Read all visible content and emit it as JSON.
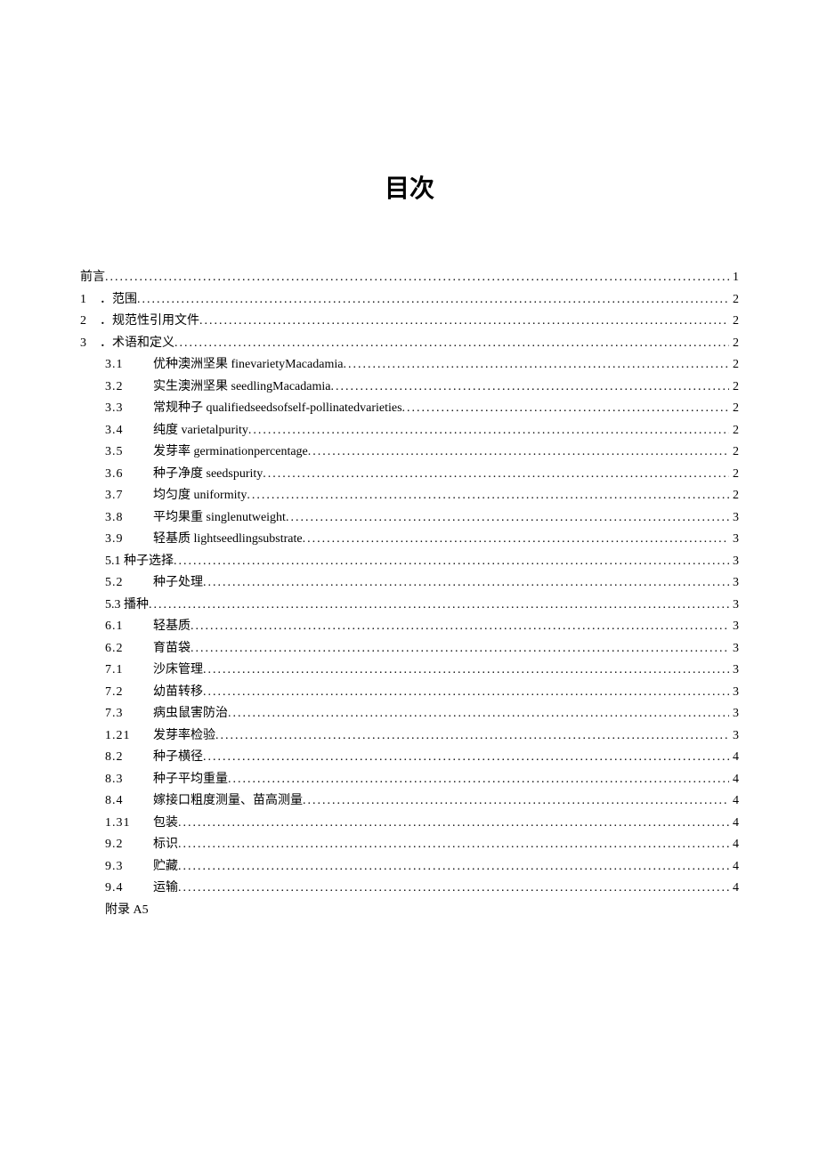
{
  "title": "目次",
  "toc": {
    "top": [
      {
        "num": "",
        "text": "前言",
        "page": "1"
      },
      {
        "num": "1",
        "text": "．范围",
        "page": "2"
      },
      {
        "num": "2",
        "text": "．规范性引用文件",
        "page": "2"
      },
      {
        "num": "3",
        "text": "．术语和定义",
        "page": "2"
      }
    ],
    "sub": [
      {
        "num": "3.1",
        "text": "优种澳洲坚果 finevarietyMacadamia",
        "page": "2"
      },
      {
        "num": "3.2",
        "text": "实生澳洲坚果 seedlingMacadamia",
        "page": "2"
      },
      {
        "num": "3.3",
        "text": "常规种子 qualifiedseedsofself-pollinatedvarieties",
        "page": "2"
      },
      {
        "num": "3.4",
        "text": "纯度 varietalpurity",
        "page": "2"
      },
      {
        "num": "3.5",
        "text": "发芽率 germinationpercentage",
        "page": "2"
      },
      {
        "num": "3.6",
        "text": "种子净度 seedspurity",
        "page": "2"
      },
      {
        "num": "3.7",
        "text": "均匀度 uniformity",
        "page": "2"
      },
      {
        "num": "3.8",
        "text": "平均果重 singlenutweight",
        "page": "3"
      },
      {
        "num": "3.9",
        "text": "轻基质 lightseedlingsubstrate",
        "page": "3"
      },
      {
        "num": "5.1 种子选择",
        "text": "",
        "page": "3",
        "merged": true
      },
      {
        "num": "5.2",
        "text": "种子处理",
        "page": "3"
      },
      {
        "num": "5.3 播种",
        "text": "",
        "page": "3",
        "merged": true
      },
      {
        "num": "6.1",
        "text": "轻基质",
        "page": "3"
      },
      {
        "num": "6.2",
        "text": "育苗袋",
        "page": "3"
      },
      {
        "num": "7.1",
        "text": "沙床管理",
        "page": "3"
      },
      {
        "num": "7.2",
        "text": "幼苗转移",
        "page": "3"
      },
      {
        "num": "7.3",
        "text": "病虫鼠害防治",
        "page": "3"
      },
      {
        "num": "1.21",
        "text": "发芽率检验",
        "page": "3"
      },
      {
        "num": "8.2",
        "text": "种子横径",
        "page": "4"
      },
      {
        "num": "8.3",
        "text": "种子平均重量",
        "page": "4"
      },
      {
        "num": "8.4",
        "text": "嫁接口粗度测量、苗高测量",
        "page": "4"
      },
      {
        "num": "1.31",
        "text": "包装",
        "page": "4"
      },
      {
        "num": "9.2",
        "text": "标识",
        "page": "4"
      },
      {
        "num": "9.3",
        "text": "贮藏",
        "page": "4"
      },
      {
        "num": "9.4",
        "text": "运输",
        "page": "4"
      }
    ],
    "appendix": "附录 A5"
  }
}
